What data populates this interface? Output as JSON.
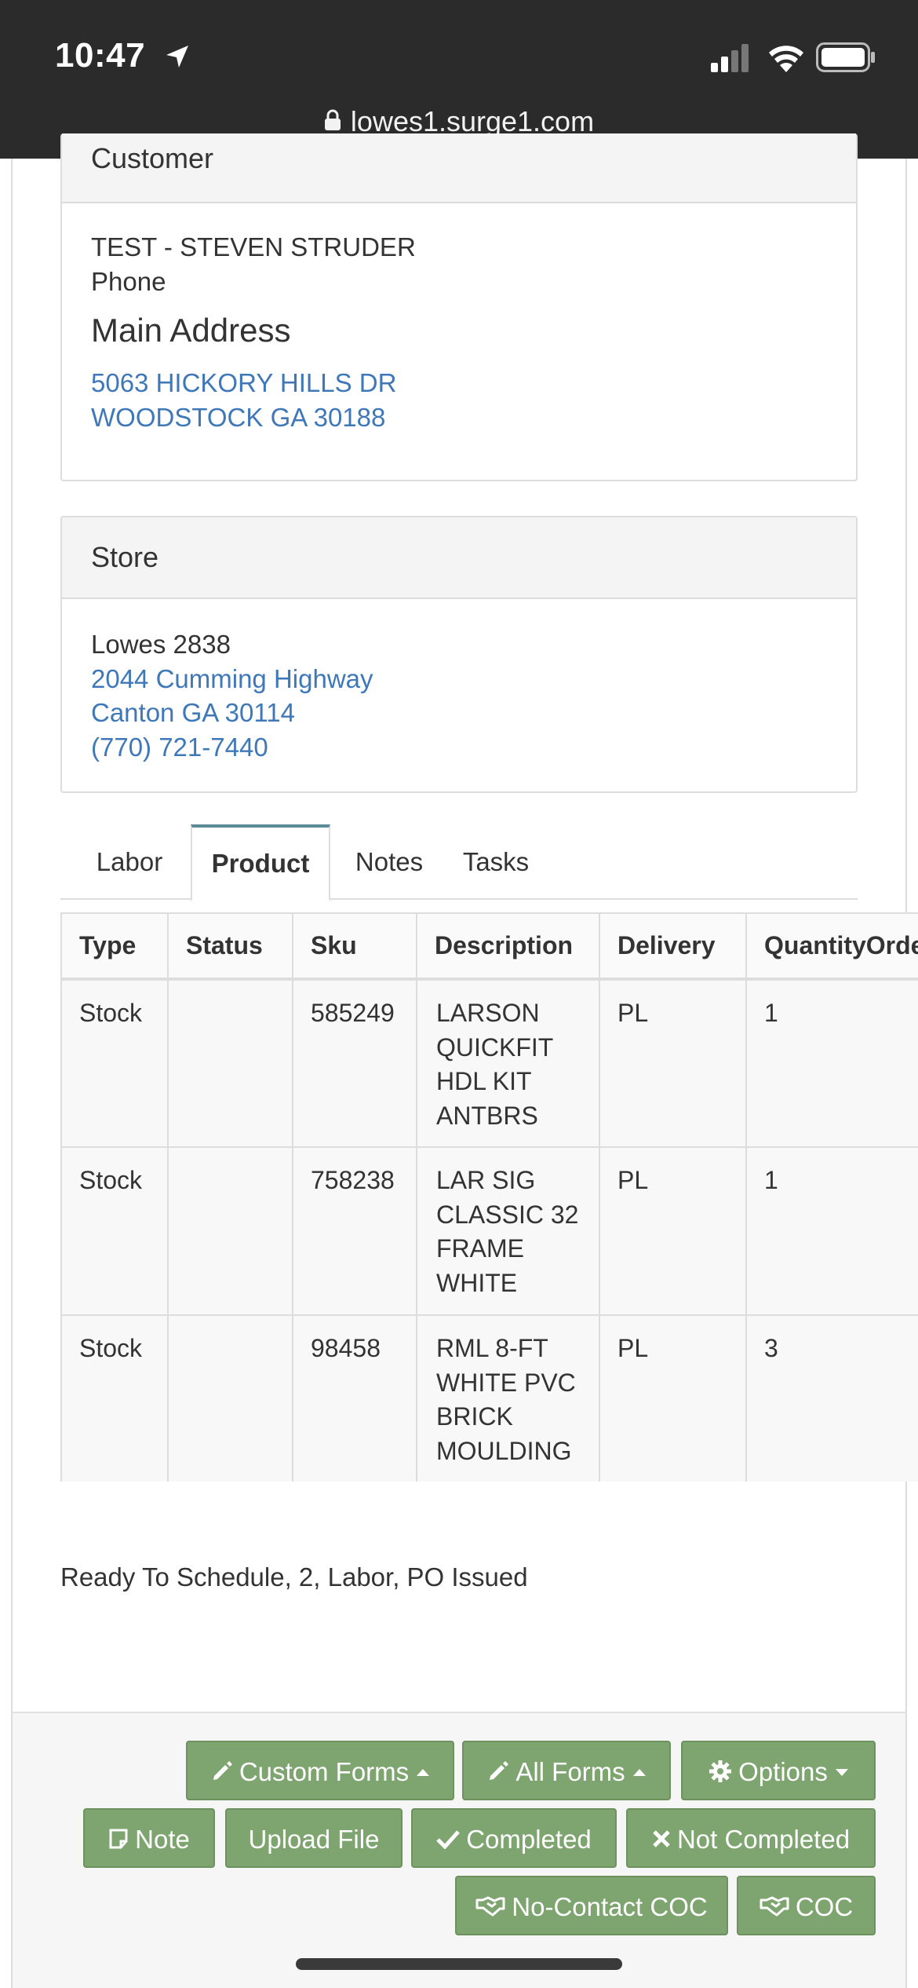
{
  "status_bar": {
    "time": "10:47",
    "url": "lowes1.surge1.com"
  },
  "customer": {
    "heading": "Customer",
    "name": "TEST - STEVEN STRUDER",
    "phone_label": "Phone",
    "address_heading": "Main Address",
    "address_line1": "5063 HICKORY HILLS DR",
    "address_line2": "WOODSTOCK GA 30188"
  },
  "store": {
    "heading": "Store",
    "name": "Lowes 2838",
    "address_line1": "2044 Cumming Highway",
    "address_line2": "Canton GA 30114",
    "phone": "(770) 721-7440"
  },
  "tabs": [
    {
      "label": "Labor",
      "active": false
    },
    {
      "label": "Product",
      "active": true
    },
    {
      "label": "Notes",
      "active": false
    },
    {
      "label": "Tasks",
      "active": false
    }
  ],
  "product_table": {
    "headers": [
      "Type",
      "Status",
      "Sku",
      "Description",
      "Delivery",
      "QuantityOrdered"
    ],
    "rows": [
      {
        "type": "Stock",
        "status": "",
        "sku": "585249",
        "description": [
          "LARSON",
          "QUICKFIT",
          "HDL KIT",
          "ANTBRS"
        ],
        "delivery": "PL",
        "quantity": "1"
      },
      {
        "type": "Stock",
        "status": "",
        "sku": "758238",
        "description": [
          "LAR SIG",
          "CLASSIC 32",
          "FRAME",
          "WHITE"
        ],
        "delivery": "PL",
        "quantity": "1"
      },
      {
        "type": "Stock",
        "status": "",
        "sku": "98458",
        "description": [
          "RML 8-FT",
          "WHITE PVC",
          "BRICK",
          "MOULDING"
        ],
        "delivery": "PL",
        "quantity": "3"
      }
    ]
  },
  "status_line": "Ready To Schedule, 2, Labor, PO Issued",
  "actions": {
    "custom_forms": "Custom Forms",
    "all_forms": "All Forms",
    "options": "Options",
    "note": "Note",
    "upload_file": "Upload File",
    "completed": "Completed",
    "not_completed": "Not Completed",
    "no_contact_coc": "No-Contact COC",
    "coc": "COC"
  },
  "colors": {
    "status_bar_bg": "#2b2b2b",
    "link": "#3f78b8",
    "button_green": "#7ea46f",
    "tab_accent": "#5b8a98"
  },
  "icons": [
    "location-arrow-icon",
    "signal-icon",
    "wifi-icon",
    "battery-icon",
    "lock-icon",
    "pencil-icon",
    "gear-icon",
    "note-icon",
    "check-icon",
    "x-icon",
    "handshake-icon"
  ]
}
